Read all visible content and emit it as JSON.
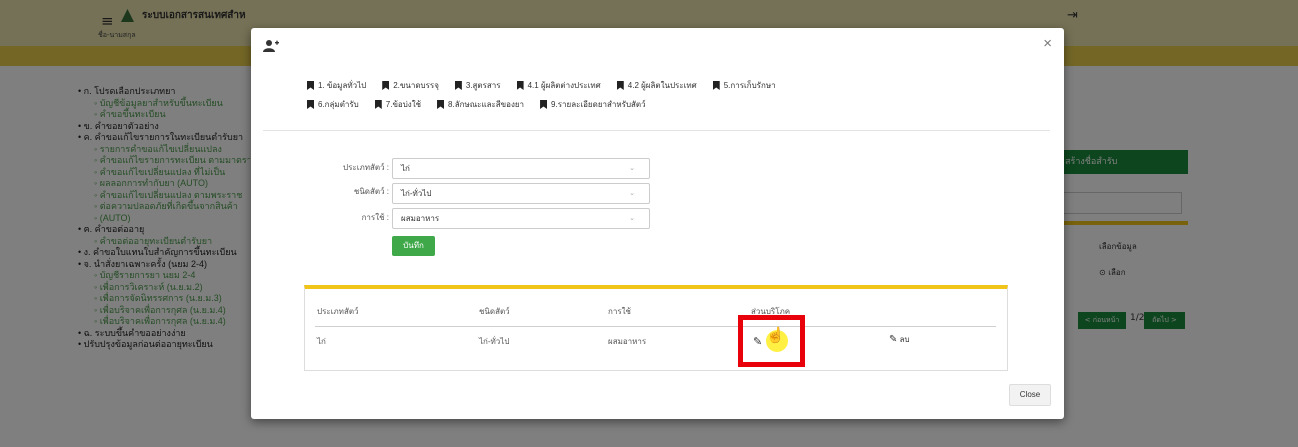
{
  "background": {
    "app_title": "ระบบเอกสารสนเทศสำหรับผู้ประกอบการด้านยา (E-SUB)",
    "user_name": "ชื่อ-นามสกุล",
    "sidebar": [
      {
        "level": 1,
        "text": "ก. โปรดเลือกประเภทยา"
      },
      {
        "level": 2,
        "text": "บัญชีข้อมูลยาสำหรับขึ้นทะเบียน"
      },
      {
        "level": 2,
        "text": "คำขอขึ้นทะเบียน"
      },
      {
        "level": 1,
        "text": "ข. คำขอยาตัวอย่าง"
      },
      {
        "level": 1,
        "text": "ค. คำขอแก้ไขรายการในทะเบียนตำรับยา"
      },
      {
        "level": 2,
        "text": "รายการคำขอแก้ไขเปลี่ยนแปลง"
      },
      {
        "level": 2,
        "text": "คำขอแก้ไขรายการทะเบียน ตามมาตรา"
      },
      {
        "level": 2,
        "text": "คำขอแก้ไขเปลี่ยนแปลง ที่ไม่เป็น"
      },
      {
        "level": 2,
        "text": "ผลลอกการทำกับยา (AUTO)"
      },
      {
        "level": 2,
        "text": "คำขอแก้ไขเปลี่ยนแปลง ตามพระราช"
      },
      {
        "level": 2,
        "text": "ต่อความปลอดภัยที่เกิดขึ้นจากสินค้า"
      },
      {
        "level": 2,
        "text": "(AUTO)"
      },
      {
        "level": 1,
        "text": "ฅ. คำขอต่ออายุ"
      },
      {
        "level": 2,
        "text": "คำขอต่ออายุทะเบียนตำรับยา"
      },
      {
        "level": 1,
        "text": "ง. คำขอใบแทนใบสำคัญการขึ้นทะเบียน"
      },
      {
        "level": 1,
        "text": "จ. นำสั่งยาเฉพาะครั้ง (นยม 2-4)"
      },
      {
        "level": 2,
        "text": "บัญชีรายการยา นยม 2-4"
      },
      {
        "level": 2,
        "text": "เพื่อการวิเคราะห์ (น.ย.ม.2)"
      },
      {
        "level": 2,
        "text": "เพื่อการจัดนิทรรศการ (น.ย.ม.3)"
      },
      {
        "level": 2,
        "text": "เพื่อบริจาคเพื่อการกุศล (น.ย.ม.4)"
      },
      {
        "level": 2,
        "text": "เพื่อบริจาคเพื่อการกุศล (น.ย.ม.4)"
      },
      {
        "level": 1,
        "text": "ฉ. ระบบขึ้นคำขออย่างง่าย"
      },
      {
        "level": 1,
        "text": "ปรับปรุงข้อมูลก่อนต่ออายุทะเบียน"
      }
    ],
    "create_btn": "สร้างชื่อสำรับ",
    "col_label": "เลือกข้อมูล",
    "eye_label": "เลือก",
    "prev_btn": "< ก่อนหน้า",
    "page_no": "1/2",
    "next_btn": "ถัดไป >"
  },
  "modal": {
    "tabs_row1": [
      "1. ข้อมูลทั่วไป",
      "2.ขนาดบรรจุ",
      "3.สูตรสาร",
      "4.1 ผู้ผลิตต่างประเทศ",
      "4.2 ผู้ผลิตในประเทศ",
      "5.การเก็บรักษา"
    ],
    "tabs_row2": [
      "6.กลุ่มตำรับ",
      "7.ข้อบ่งใช้",
      "8.ลักษณะและสีของยา",
      "9.รายละเอียดยาสำหรับสัตว์"
    ],
    "form": {
      "animal_type_label": "ประเภทสัตว์ :",
      "animal_type_value": "ไก่",
      "animal_kind_label": "ชนิดสัตว์ :",
      "animal_kind_value": "ไก่-ทั่วไป",
      "usage_label": "การใช้ :",
      "usage_value": "ผสมอาหาร",
      "save_label": "บันทึก"
    },
    "table": {
      "headers": [
        "ประเภทสัตว์",
        "ชนิดสัตว์",
        "การใช้",
        "ส่วนบริโภค"
      ],
      "rows": [
        {
          "type": "ไก่",
          "kind": "ไก่-ทั่วไป",
          "usage": "ผสมอาหาร",
          "delete_label": "ลบ"
        }
      ]
    },
    "close_label": "Close"
  }
}
